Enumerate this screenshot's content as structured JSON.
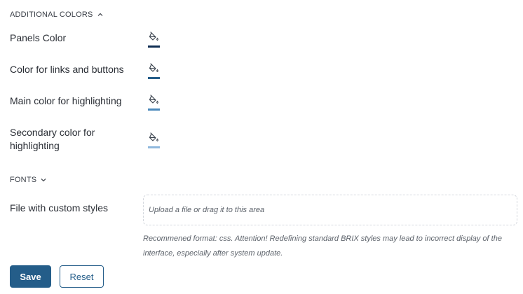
{
  "additional_colors": {
    "header": "ADDITIONAL COLORS",
    "chevron_icon": "chevron-up-icon",
    "items": [
      {
        "label": "Panels Color",
        "color": "#0f2d52"
      },
      {
        "label": "Color for links and buttons",
        "color": "#245d89"
      },
      {
        "label": "Main color for highlighting",
        "color": "#4a88bb"
      },
      {
        "label": "Secondary color for highlighting",
        "color": "#8fb8de"
      }
    ],
    "picker_icon": "paint-bucket-icon"
  },
  "fonts": {
    "header": "FONTS",
    "chevron_icon": "chevron-down-icon"
  },
  "custom_styles": {
    "label": "File with custom styles",
    "dropzone_text": "Upload a file or drag it to this area",
    "hint": "Recommened format: css. Attention! Redefining standard BRIX styles may lead to incorrect display of the interface, especially after system update."
  },
  "actions": {
    "save_label": "Save",
    "reset_label": "Reset"
  },
  "colors": {
    "primary": "#245d89",
    "text": "#2b2f36",
    "muted": "#5d636b"
  }
}
